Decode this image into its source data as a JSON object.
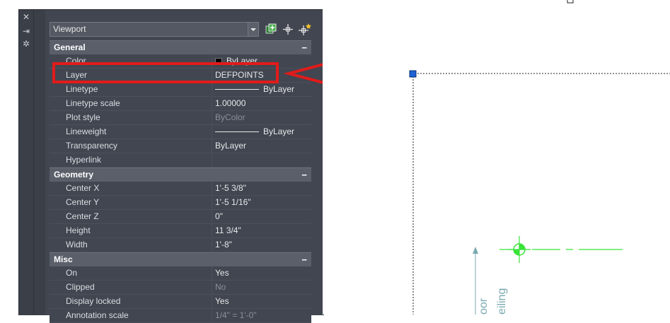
{
  "palette": {
    "titlebar_icons": [
      "close-icon",
      "auto-hide-icon",
      "properties-settings-icon"
    ],
    "object_type": "Viewport",
    "toolbar": [
      "toggle-pickadd-icon",
      "select-objects-icon",
      "quick-select-icon"
    ]
  },
  "sections": [
    {
      "title": "General",
      "collapse": "−",
      "rows": [
        {
          "label": "Color",
          "value": "ByLayer",
          "swatch": true,
          "dim": false
        },
        {
          "label": "Layer",
          "value": "DEFPOINTS",
          "dim": false
        },
        {
          "label": "Linetype",
          "value": "ByLayer",
          "line": true,
          "dim": false
        },
        {
          "label": "Linetype scale",
          "value": "1.00000",
          "dim": false
        },
        {
          "label": "Plot style",
          "value": "ByColor",
          "dim": true
        },
        {
          "label": "Lineweight",
          "value": "ByLayer",
          "line": true,
          "dim": false
        },
        {
          "label": "Transparency",
          "value": "ByLayer",
          "dim": false
        },
        {
          "label": "Hyperlink",
          "value": "",
          "dim": false
        }
      ]
    },
    {
      "title": "Geometry",
      "collapse": "−",
      "rows": [
        {
          "label": "Center X",
          "value": "1'-5 3/8\"",
          "dim": false
        },
        {
          "label": "Center Y",
          "value": "1'-5 1/16\"",
          "dim": false
        },
        {
          "label": "Center Z",
          "value": "0\"",
          "dim": false
        },
        {
          "label": "Height",
          "value": "11 3/4\"",
          "dim": false
        },
        {
          "label": "Width",
          "value": "1'-8\"",
          "dim": false
        }
      ]
    },
    {
      "title": "Misc",
      "collapse": "−",
      "rows": [
        {
          "label": "On",
          "value": "Yes",
          "dim": false
        },
        {
          "label": "Clipped",
          "value": "No",
          "dim": true
        },
        {
          "label": "Display locked",
          "value": "Yes",
          "dim": false
        },
        {
          "label": "Annotation scale",
          "value": "1/4\" = 1'-0\"",
          "dim": true
        }
      ]
    }
  ],
  "drawing": {
    "vertical_labels": [
      "oor",
      "eiling"
    ]
  },
  "colors": {
    "callout": "#e11b1b",
    "viewport_grip": "#1e63d6",
    "green": "#38e338",
    "cyan_text": "#7aa9b0"
  }
}
